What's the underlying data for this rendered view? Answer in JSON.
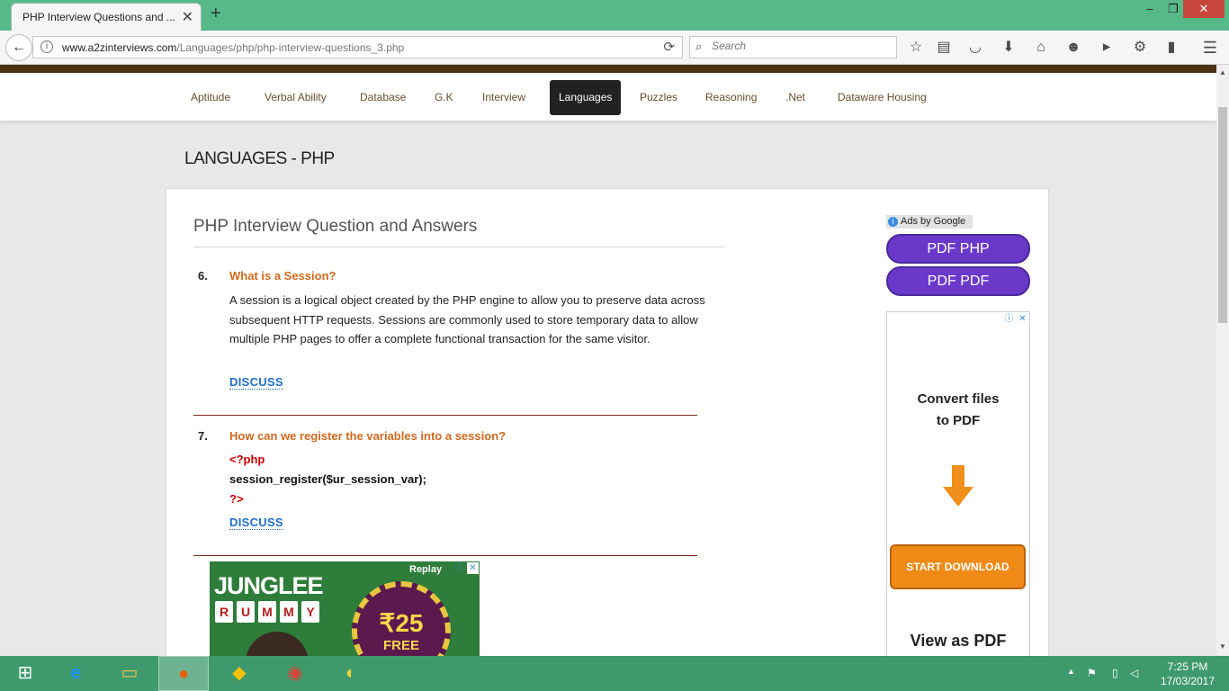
{
  "browser": {
    "tab_title": "PHP Interview Questions and ...",
    "url_host": "www.a2zinterviews.com",
    "url_path": "/Languages/php/php-interview-questions_3.php",
    "search_placeholder": "Search"
  },
  "site_nav": {
    "items": [
      "Aptitude",
      "Verbal Ability",
      "Database",
      "G.K",
      "Interview",
      "Languages",
      "Puzzles",
      "Reasoning",
      ".Net",
      "Dataware Housing"
    ],
    "active": "Languages"
  },
  "page": {
    "section_heading": "LANGUAGES - PHP",
    "content_title": "PHP Interview Question and Answers",
    "questions": [
      {
        "number": "6.",
        "question": "What is a Session?",
        "answer": "A session is a logical object created by the PHP engine to allow you to preserve data across subsequent HTTP requests. Sessions are commonly used to store temporary data to allow multiple PHP pages to offer a complete functional transaction for the same visitor.",
        "discuss": "DISCUSS"
      },
      {
        "number": "7.",
        "question": "How can we register the variables into a session?",
        "code": [
          "<?php",
          "session_register($ur_session_var);",
          "?>"
        ],
        "discuss": "DISCUSS"
      }
    ]
  },
  "ads": {
    "ads_by_google": "Ads by Google",
    "pdf_buttons": [
      "PDF PHP",
      "PDF PDF"
    ],
    "convert_line1": "Convert files",
    "convert_line2": "to PDF",
    "start_download": "START DOWNLOAD",
    "view_as_pdf": "View as PDF",
    "rummy_title": "JUNGLEE",
    "rummy_letters": [
      "R",
      "U",
      "M",
      "M",
      "Y"
    ],
    "rummy_amount": "₹25",
    "rummy_free": "FREE",
    "rummy_replay": "Replay"
  },
  "taskbar": {
    "time": "7:25 PM",
    "date": "17/03/2017"
  },
  "colors": {
    "titlebar": "#57b98a",
    "question_orange": "#d2691e",
    "discuss_blue": "#1f6fce",
    "code_red": "#cc0000",
    "pdf_purple": "#6a39c9",
    "download_orange": "#f08a17",
    "taskbar": "#3e9a6d"
  }
}
